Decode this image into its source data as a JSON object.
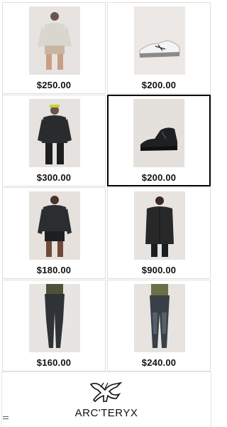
{
  "products": [
    {
      "price": "$250.00",
      "image": "beige-shirt-model-photo"
    },
    {
      "price": "$200.00",
      "image": "white-trail-shoe-photo"
    },
    {
      "price": "$300.00",
      "image": "black-jacket-model-photo"
    },
    {
      "price": "$200.00",
      "image": "black-hiking-boot-photo"
    },
    {
      "price": "$180.00",
      "image": "black-running-jacket-model-photo"
    },
    {
      "price": "$900.00",
      "image": "black-coat-model-photo"
    },
    {
      "price": "$160.00",
      "image": "gray-pants-model-photo"
    },
    {
      "price": "$240.00",
      "image": "gray-climbing-pants-model-photo"
    }
  ],
  "selected_index": 3,
  "footer": {
    "brand": "ARC'TERYX",
    "logo": "archaeopteryx-logo-icon"
  },
  "menu_icon": "menu-icon"
}
